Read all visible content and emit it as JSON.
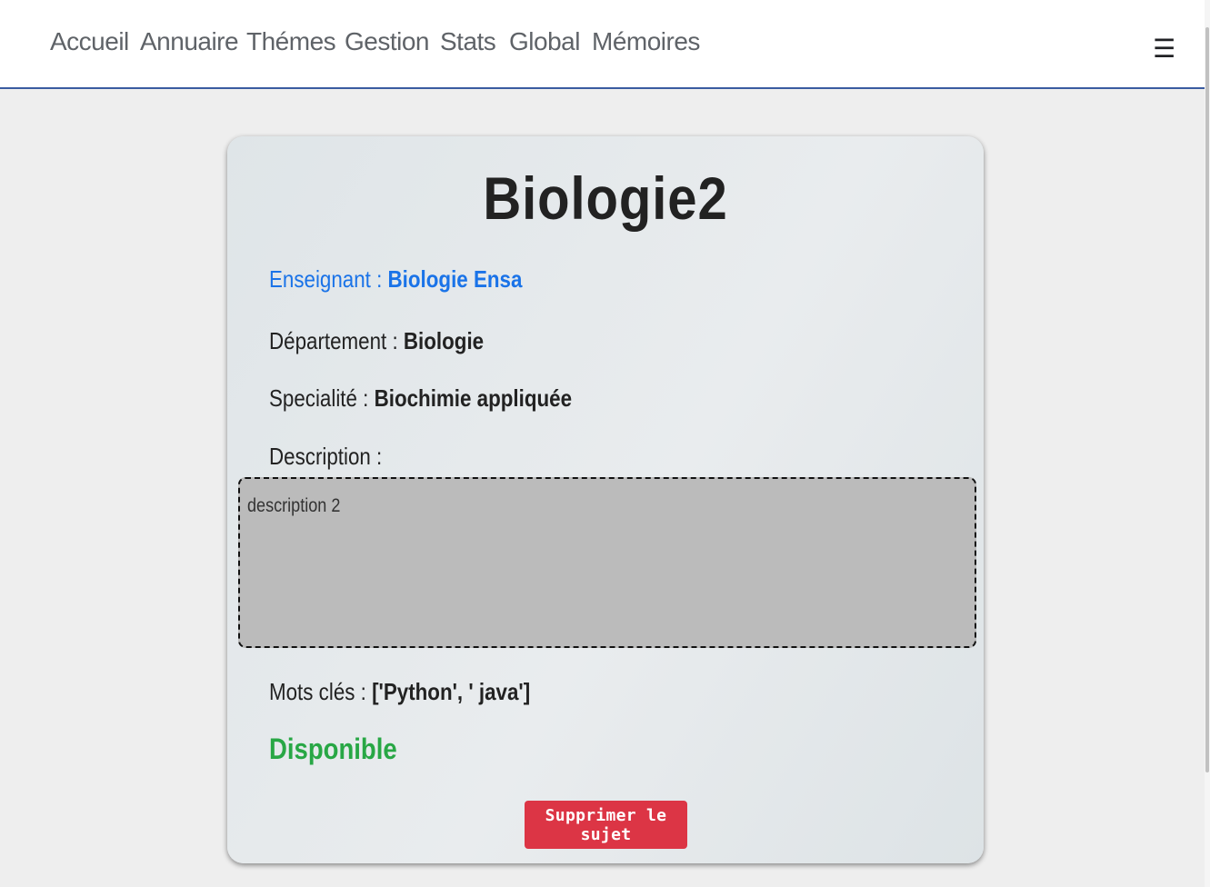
{
  "nav": {
    "links": [
      "Accueil",
      "Annuaire",
      "Thémes",
      "Gestion",
      "Stats",
      "Global",
      "Mémoires"
    ],
    "menu_icon": "hamburger-icon",
    "menu_glyph": "☰"
  },
  "subject": {
    "title": "Biologie2",
    "teacher_label": "Enseignant : ",
    "teacher_value": "Biologie Ensa",
    "department_label": "Département : ",
    "department_value": "Biologie",
    "specialty_label": "Specialité : ",
    "specialty_value": "Biochimie appliquée",
    "description_label": "Description :",
    "description_value": "description 2",
    "keywords_label": "Mots clés : ",
    "keywords_value": "['Python', ' java']",
    "status": "Disponible",
    "delete_label": "Supprimer le sujet"
  },
  "colors": {
    "teacher": "#1a73e8",
    "status": "#28a745",
    "delete_button": "#dc3545",
    "nav_border": "#3a5ba0"
  }
}
